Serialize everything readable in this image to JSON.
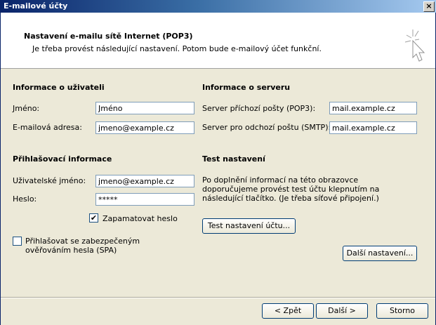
{
  "window": {
    "title": "E-mailové účty",
    "close_label": "×"
  },
  "header": {
    "title": "Nastavení e-mailu sítě Internet (POP3)",
    "subtitle": "Je třeba provést následující nastavení. Potom bude e-mailový účet funkční."
  },
  "user_info": {
    "heading": "Informace o uživateli",
    "name_label": "Jméno:",
    "name_value": "Jméno",
    "email_label": "E-mailová adresa:",
    "email_value": "jmeno@example.cz"
  },
  "server_info": {
    "heading": "Informace o serveru",
    "incoming_label": "Server příchozí pošty (POP3):",
    "incoming_value": "mail.example.cz",
    "outgoing_label": "Server pro odchozí poštu (SMTP):",
    "outgoing_value": "mail.example.cz"
  },
  "login_info": {
    "heading": "Přihlašovací informace",
    "username_label": "Uživatelské jméno:",
    "username_value": "jmeno@example.cz",
    "password_label": "Heslo:",
    "password_value": "*****",
    "remember_label": "Zapamatovat heslo",
    "remember_checked": "✔",
    "spa_label_line1": "Přihlašovat se zabezpečeným",
    "spa_label_line2": "ověřováním hesla (SPA)"
  },
  "test": {
    "heading": "Test nastavení",
    "description_line1": "Po doplnění informací na této obrazovce",
    "description_line2": "doporučujeme provést test účtu klepnutím na",
    "description_line3": "následující tlačítko. (Je třeba síťové připojení.)",
    "test_button": "Test nastavení účtu..."
  },
  "buttons": {
    "more_settings": "Další nastavení...",
    "back": "< Zpět",
    "next": "Další >",
    "cancel": "Storno"
  }
}
